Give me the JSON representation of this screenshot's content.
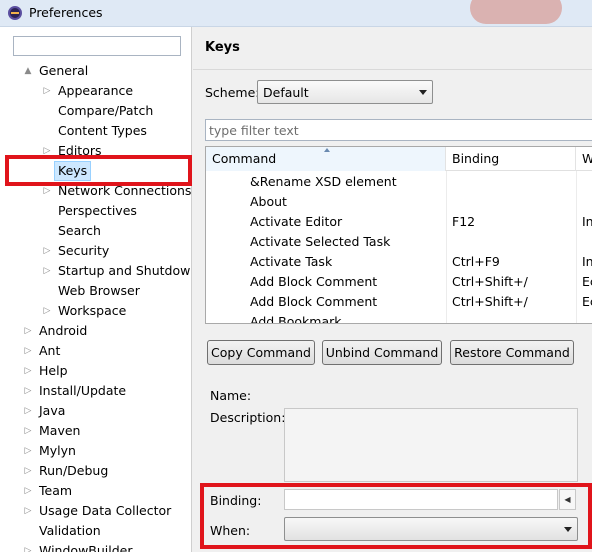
{
  "window": {
    "title": "Preferences"
  },
  "tree": {
    "filter_value": "",
    "items": [
      {
        "label": "General",
        "expander": "▲"
      },
      {
        "label": "Appearance",
        "expander": "▷"
      },
      {
        "label": "Compare/Patch",
        "expander": ""
      },
      {
        "label": "Content Types",
        "expander": ""
      },
      {
        "label": "Editors",
        "expander": "▷"
      },
      {
        "label": "Keys",
        "expander": ""
      },
      {
        "label": "Network Connections",
        "expander": "▷"
      },
      {
        "label": "Perspectives",
        "expander": ""
      },
      {
        "label": "Search",
        "expander": ""
      },
      {
        "label": "Security",
        "expander": "▷"
      },
      {
        "label": "Startup and Shutdow",
        "expander": "▷"
      },
      {
        "label": "Web Browser",
        "expander": ""
      },
      {
        "label": "Workspace",
        "expander": "▷"
      },
      {
        "label": "Android",
        "expander": "▷"
      },
      {
        "label": "Ant",
        "expander": "▷"
      },
      {
        "label": "Help",
        "expander": "▷"
      },
      {
        "label": "Install/Update",
        "expander": "▷"
      },
      {
        "label": "Java",
        "expander": "▷"
      },
      {
        "label": "Maven",
        "expander": "▷"
      },
      {
        "label": "Mylyn",
        "expander": "▷"
      },
      {
        "label": "Run/Debug",
        "expander": "▷"
      },
      {
        "label": "Team",
        "expander": "▷"
      },
      {
        "label": "Usage Data Collector",
        "expander": "▷"
      },
      {
        "label": "Validation",
        "expander": ""
      },
      {
        "label": "WindowBuilder",
        "expander": "▷"
      }
    ]
  },
  "keys_page": {
    "title": "Keys",
    "scheme_label": "Scheme:",
    "scheme_value": "Default",
    "filter_placeholder": "type filter text",
    "table": {
      "columns": [
        "Command",
        "Binding",
        "W"
      ],
      "rows": [
        {
          "command": "&Rename XSD element",
          "binding": "",
          "when": ""
        },
        {
          "command": "About",
          "binding": "",
          "when": ""
        },
        {
          "command": "Activate Editor",
          "binding": "F12",
          "when": "In"
        },
        {
          "command": "Activate Selected Task",
          "binding": "",
          "when": ""
        },
        {
          "command": "Activate Task",
          "binding": "Ctrl+F9",
          "when": "In"
        },
        {
          "command": "Add Block Comment",
          "binding": "Ctrl+Shift+/",
          "when": "Ec"
        },
        {
          "command": "Add Block Comment",
          "binding": "Ctrl+Shift+/",
          "when": "Ec"
        },
        {
          "command": "Add Bookmark",
          "binding": "",
          "when": ""
        }
      ]
    },
    "buttons": {
      "copy": "Copy Command",
      "unbind": "Unbind Command",
      "restore": "Restore Command"
    },
    "name_label": "Name:",
    "description_label": "Description:",
    "binding_label": "Binding:",
    "binding_value": "",
    "when_label": "When:",
    "when_value": ""
  },
  "colors": {
    "highlight": "#e0141b",
    "selection": "#cde8ff"
  }
}
